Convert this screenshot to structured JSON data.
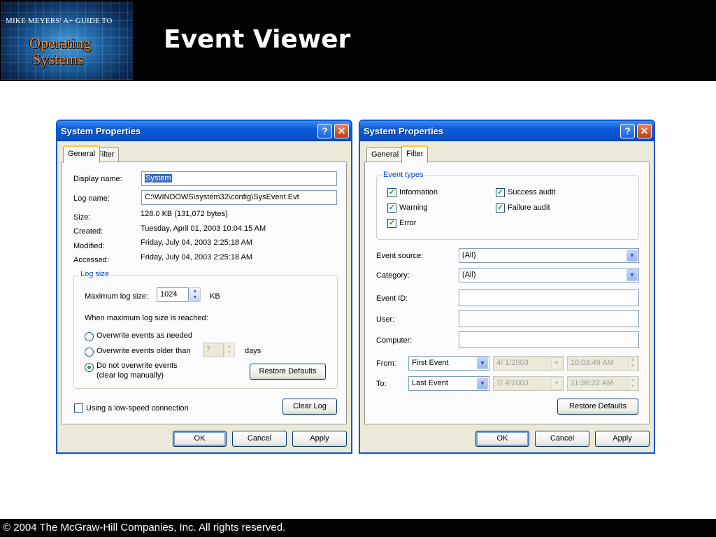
{
  "slide": {
    "logo": {
      "line1": "MIKE MEYERS' A+ GUIDE TO",
      "line2": "Operating",
      "line3": "Systems"
    },
    "title": "Event Viewer",
    "footer": "© 2004 The McGraw-Hill Companies, Inc. All rights reserved."
  },
  "dialog_general": {
    "title": "System Properties",
    "help_glyph": "?",
    "close_glyph": "✕",
    "tabs": [
      "General",
      "Filter"
    ],
    "active_tab": "General",
    "display_name_label": "Display name:",
    "display_name_value": "System",
    "log_name_label": "Log name:",
    "log_name_value": "C:\\WINDOWS\\system32\\config\\SysEvent.Evt",
    "size_label": "Size:",
    "size_value": "128.0 KB (131,072 bytes)",
    "created_label": "Created:",
    "created_value": "Tuesday, April 01, 2003 10:04:15 AM",
    "modified_label": "Modified:",
    "modified_value": "Friday, July 04, 2003 2:25:18 AM",
    "accessed_label": "Accessed:",
    "accessed_value": "Friday, July 04, 2003 2:25:18 AM",
    "log_size_group": "Log size",
    "max_log_size_label": "Maximum log size:",
    "max_log_size_value": "1024",
    "max_log_size_unit": "KB",
    "when_max_label": "When maximum log size is reached:",
    "opt_overwrite_needed": "Overwrite events as needed",
    "opt_overwrite_older": "Overwrite events older than",
    "days_value": "7",
    "days_label": "days",
    "opt_do_not_overwrite_1": "Do not overwrite events",
    "opt_do_not_overwrite_2": "(clear log manually)",
    "selected_option": "do_not_overwrite",
    "restore_defaults": "Restore Defaults",
    "low_speed_label": "Using a low-speed connection",
    "low_speed_checked": false,
    "clear_log": "Clear Log",
    "ok": "OK",
    "cancel": "Cancel",
    "apply": "Apply"
  },
  "dialog_filter": {
    "title": "System Properties",
    "help_glyph": "?",
    "close_glyph": "✕",
    "tabs": [
      "General",
      "Filter"
    ],
    "active_tab": "Filter",
    "event_types_group": "Event types",
    "information": "Information",
    "warning": "Warning",
    "error": "Error",
    "success_audit": "Success audit",
    "failure_audit": "Failure audit",
    "check_mark": "✓",
    "event_source_label": "Event source:",
    "event_source_value": "(All)",
    "category_label": "Category:",
    "category_value": "(All)",
    "event_id_label": "Event ID:",
    "event_id_value": "",
    "user_label": "User:",
    "user_value": "",
    "computer_label": "Computer:",
    "computer_value": "",
    "from_label": "From:",
    "from_value": "First Event",
    "from_date": "4/ 1/2003",
    "from_time": "10:03:49 AM",
    "to_label": "To:",
    "to_value": "Last Event",
    "to_date": "7/ 4/2003",
    "to_time": "11:36:22 AM",
    "restore_defaults": "Restore Defaults",
    "ok": "OK",
    "cancel": "Cancel",
    "apply": "Apply"
  },
  "colors": {
    "titlebar": "#0a5ad8",
    "dialog_bg": "#ece9d8",
    "group_title": "#0046d5",
    "check": "#22a122"
  }
}
